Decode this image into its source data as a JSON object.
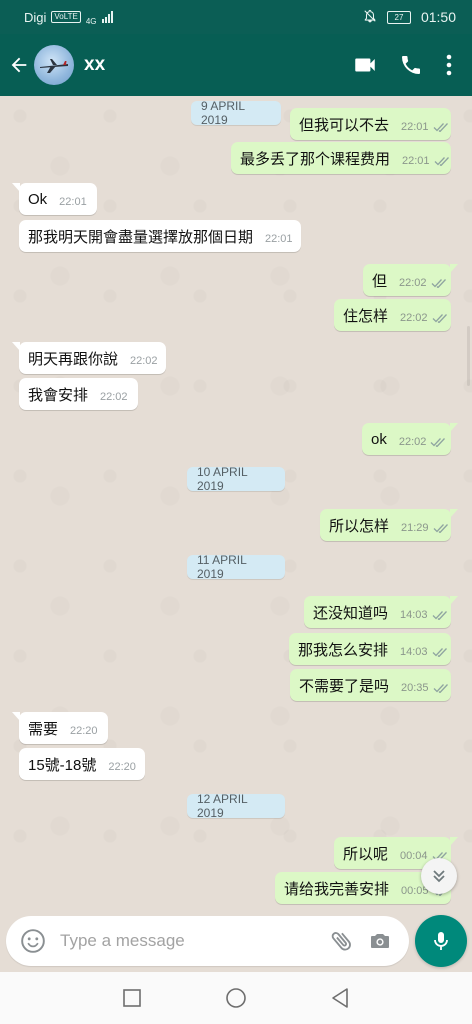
{
  "status_bar": {
    "carrier": "Digi",
    "volte": "VoLTE",
    "network": "4G",
    "battery": "27",
    "time": "01:50"
  },
  "header": {
    "contact_name": "xx"
  },
  "icons": {
    "back": "arrow-left-icon",
    "video": "video-call-icon",
    "call": "phone-icon",
    "menu": "more-vert-icon",
    "emoji": "emoji-icon",
    "attach": "paperclip-icon",
    "camera": "camera-icon",
    "mic": "mic-icon",
    "read": "double-check-icon",
    "scroll": "chevron-double-down-icon"
  },
  "messages": [
    {
      "type": "date",
      "text": "9 APRIL 2019"
    },
    {
      "type": "out",
      "text": "但我可以不去",
      "time": "22:01"
    },
    {
      "type": "out",
      "text": "最多丢了那个课程费用",
      "time": "22:01"
    },
    {
      "type": "in",
      "text": "Ok",
      "time": "22:01"
    },
    {
      "type": "in",
      "text": "那我明天開會盡量選擇放那個日期",
      "time": "22:01"
    },
    {
      "type": "out",
      "text": "但",
      "time": "22:02"
    },
    {
      "type": "out",
      "text": "住怎样",
      "time": "22:02"
    },
    {
      "type": "in",
      "text": "明天再跟你說",
      "time": "22:02"
    },
    {
      "type": "in",
      "text": "我會安排",
      "time": "22:02"
    },
    {
      "type": "out",
      "text": "ok",
      "time": "22:02"
    },
    {
      "type": "date",
      "text": "10 APRIL 2019"
    },
    {
      "type": "out",
      "text": "所以怎样",
      "time": "21:29"
    },
    {
      "type": "date",
      "text": "11 APRIL 2019"
    },
    {
      "type": "out",
      "text": "还没知道吗",
      "time": "14:03"
    },
    {
      "type": "out",
      "text": "那我怎么安排",
      "time": "14:03"
    },
    {
      "type": "out",
      "text": "不需要了是吗",
      "time": "20:35"
    },
    {
      "type": "in",
      "text": "需要",
      "time": "22:20"
    },
    {
      "type": "in",
      "text": "15號-18號",
      "time": "22:20"
    },
    {
      "type": "date",
      "text": "12 APRIL 2019"
    },
    {
      "type": "out",
      "text": "所以呢",
      "time": "00:04"
    },
    {
      "type": "out",
      "text": "请给我完善安排",
      "time": "00:05"
    }
  ],
  "composer": {
    "placeholder": "Type a message",
    "value": ""
  },
  "colors": {
    "header": "#075e54",
    "status_bar": "#0b5e55",
    "outgoing": "#dcf8c6",
    "incoming": "#ffffff",
    "accent": "#00897b",
    "read_tick": "#8fa4a0"
  }
}
